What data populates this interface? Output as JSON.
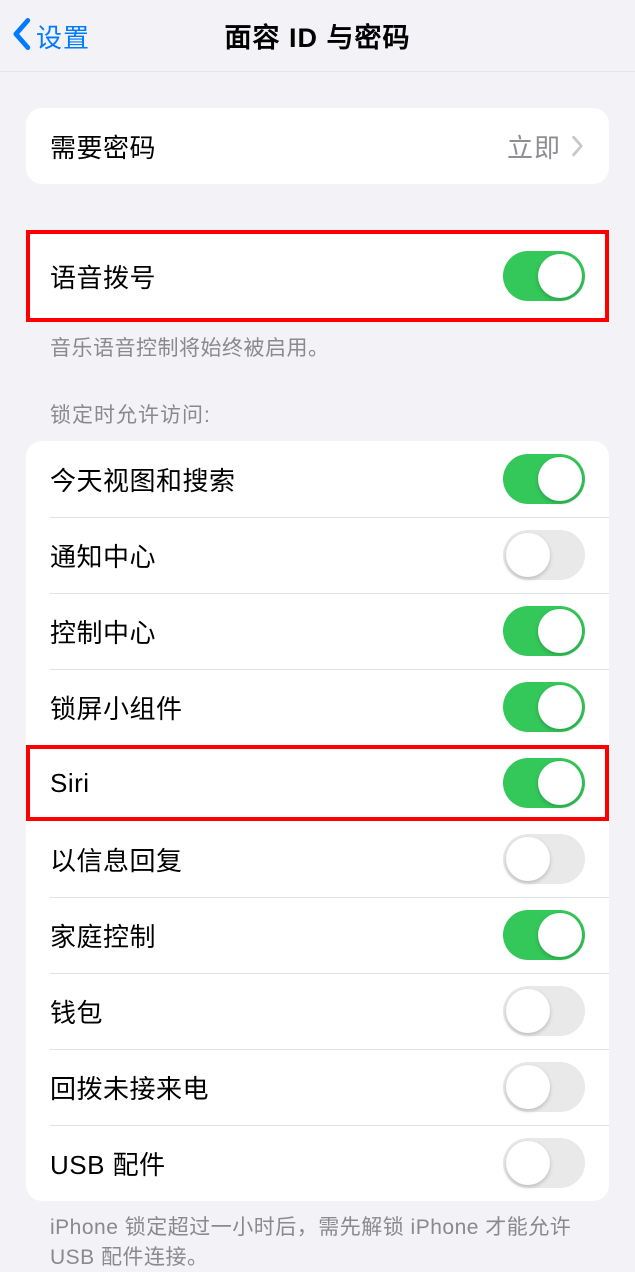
{
  "header": {
    "back_label": "设置",
    "title": "面容 ID 与密码"
  },
  "passcode_row": {
    "label": "需要密码",
    "value": "立即"
  },
  "voice_dial": {
    "label": "语音拨号",
    "footer": "音乐语音控制将始终被启用。",
    "enabled": true
  },
  "locked_access": {
    "header": "锁定时允许访问:",
    "items": [
      {
        "label": "今天视图和搜索",
        "enabled": true
      },
      {
        "label": "通知中心",
        "enabled": false
      },
      {
        "label": "控制中心",
        "enabled": true
      },
      {
        "label": "锁屏小组件",
        "enabled": true
      },
      {
        "label": "Siri",
        "enabled": true
      },
      {
        "label": "以信息回复",
        "enabled": false
      },
      {
        "label": "家庭控制",
        "enabled": true
      },
      {
        "label": "钱包",
        "enabled": false
      },
      {
        "label": "回拨未接来电",
        "enabled": false
      },
      {
        "label": "USB 配件",
        "enabled": false
      }
    ],
    "footer": "iPhone 锁定超过一小时后，需先解锁 iPhone 才能允许USB 配件连接。"
  }
}
